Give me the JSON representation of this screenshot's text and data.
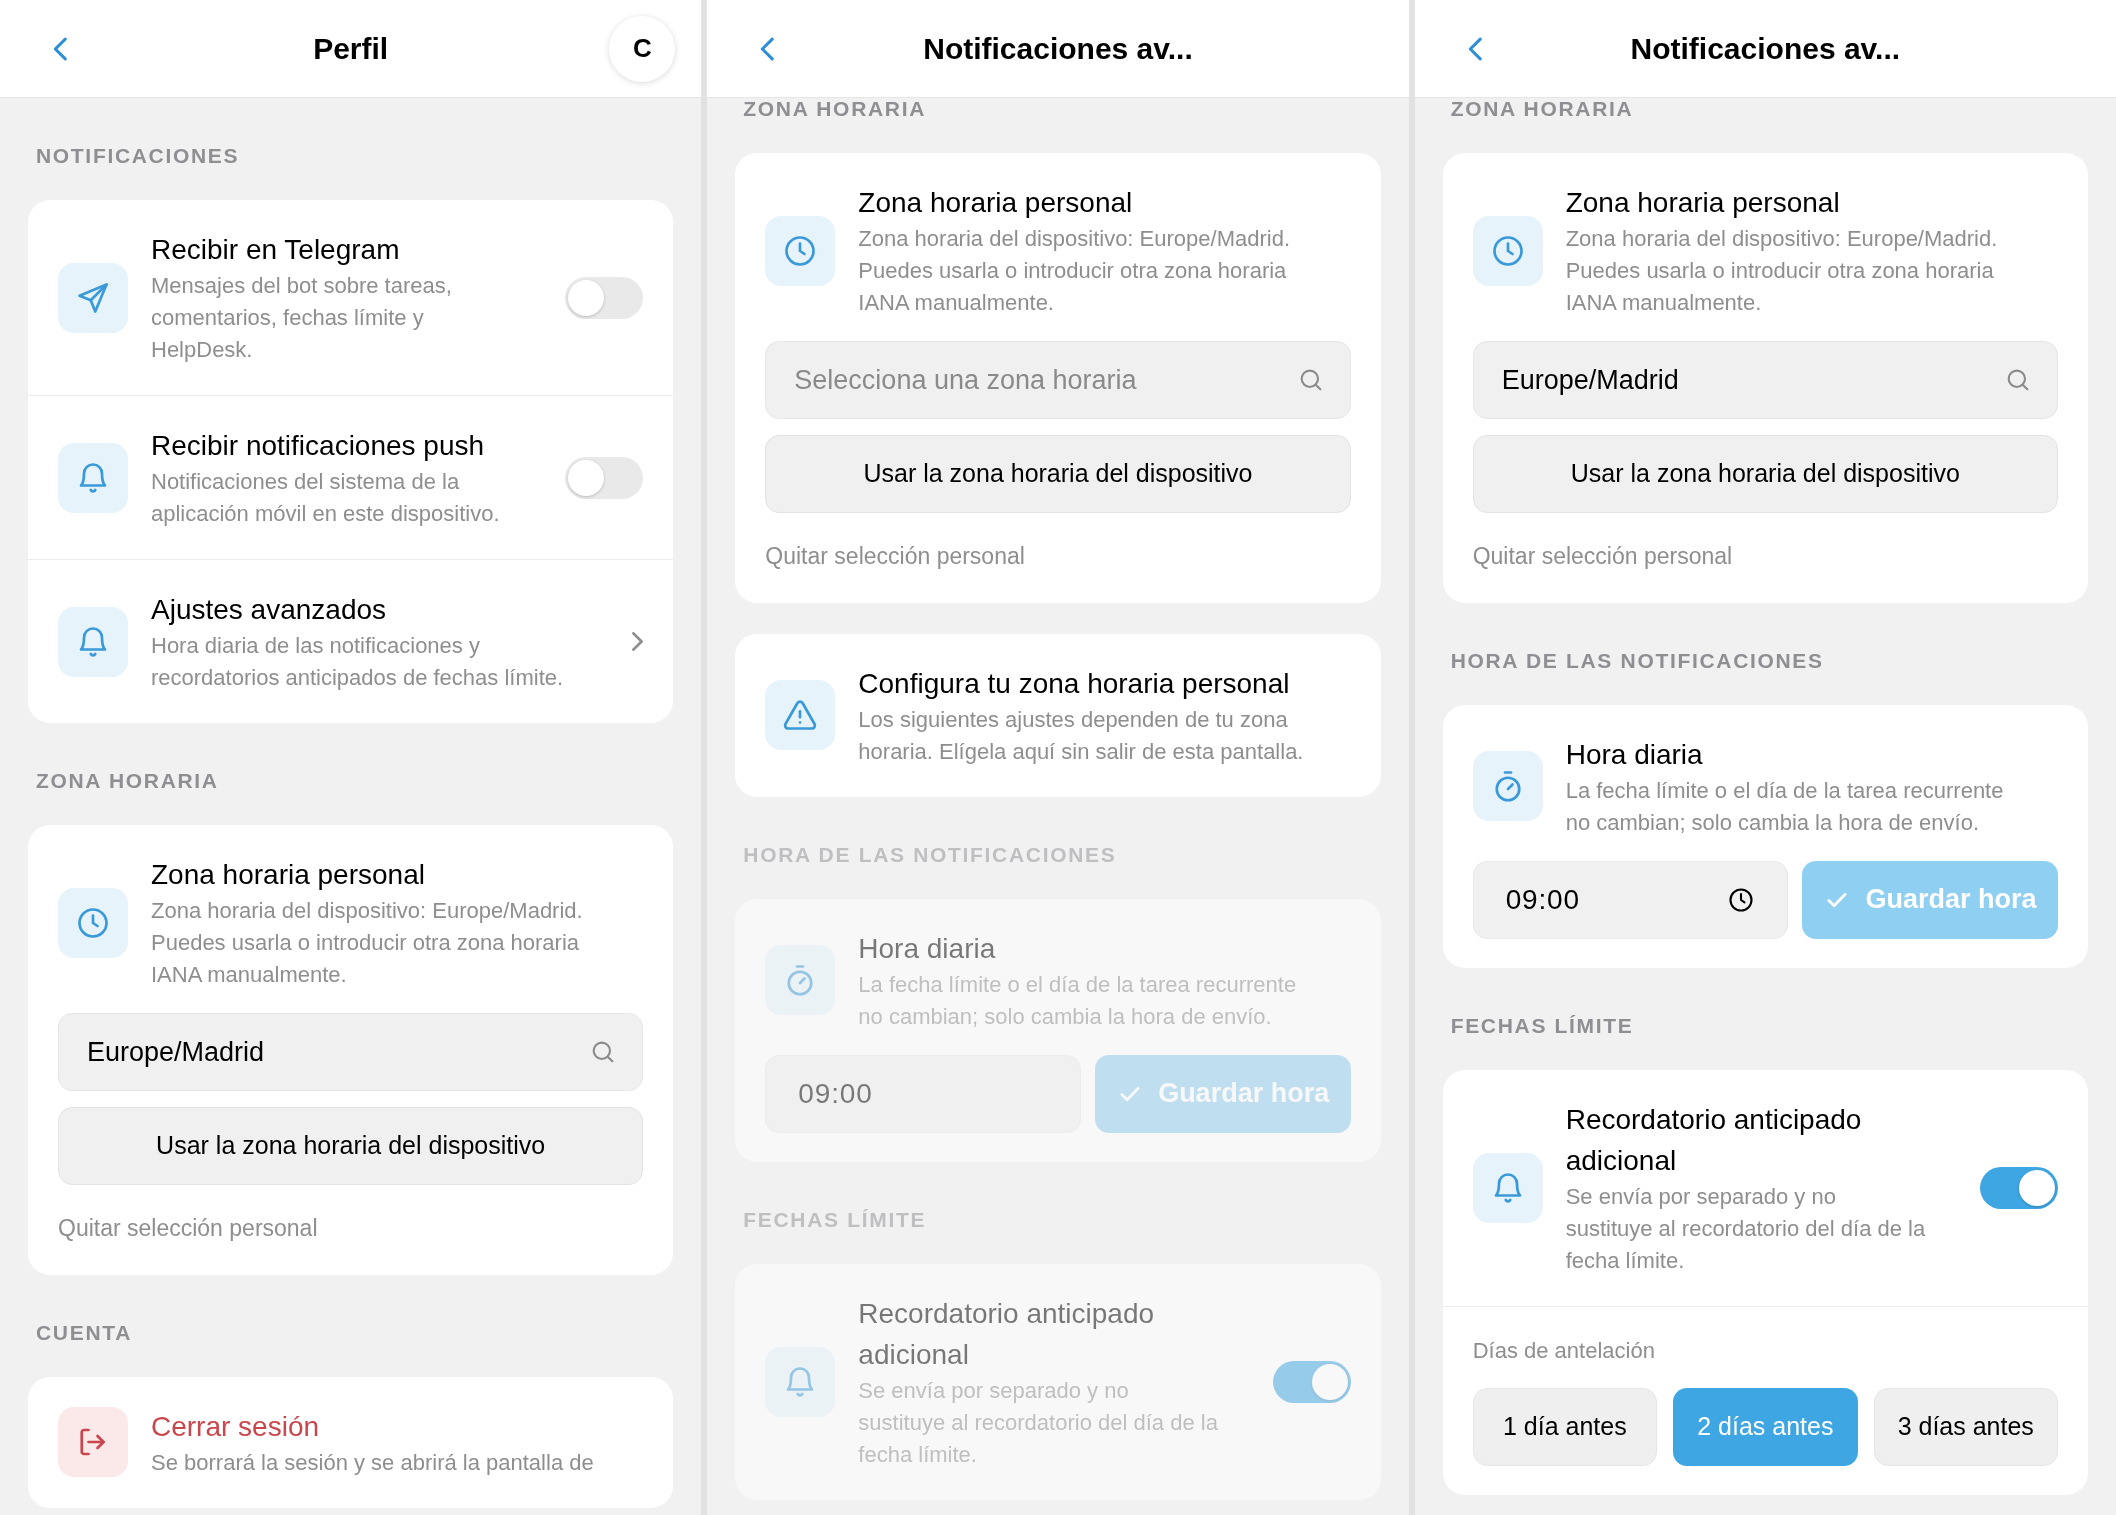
{
  "panels": [
    {
      "header": {
        "title": "Perfil",
        "avatar": "C"
      },
      "scrolled": false,
      "sections": [
        {
          "heading": "NOTIFICACIONES",
          "disabled": false,
          "items": [
            {
              "kind": "telegram",
              "title": "Recibir en Telegram",
              "description": "Mensajes del bot sobre tareas, comentarios, fechas límite y HelpDesk.",
              "on": false
            },
            {
              "kind": "push",
              "title": "Recibir notificaciones push",
              "description": "Notificaciones del sistema de la aplicación móvil en este dispositivo.",
              "on": false
            },
            {
              "kind": "advanced",
              "title": "Ajustes avanzados",
              "description": "Hora diaria de las notificaciones y recordatorios anticipados de fechas límite."
            }
          ]
        },
        {
          "heading": "ZONA HORARIA",
          "disabled": false,
          "items": [
            {
              "kind": "timezone",
              "title": "Zona horaria personal",
              "description": "Zona horaria del dispositivo: Europe/Madrid. Puedes usarla o introducir otra zona horaria IANA manualmente.",
              "field": {
                "value": "Europe/Madrid"
              },
              "button": "Usar la zona horaria del dispositivo",
              "link": "Quitar selección personal"
            }
          ]
        },
        {
          "heading": "CUENTA",
          "disabled": false,
          "items": [
            {
              "kind": "logout",
              "title": "Cerrar sesión",
              "description": "Se borrará la sesión y se abrirá la pantalla de"
            }
          ]
        }
      ]
    },
    {
      "header": {
        "title": "Notificaciones av..."
      },
      "scrolled": true,
      "sections": [
        {
          "heading": "ZONA HORARIA",
          "disabled": false,
          "items": [
            {
              "kind": "timezone",
              "title": "Zona horaria personal",
              "description": "Zona horaria del dispositivo: Europe/Madrid. Puedes usarla o introducir otra zona horaria IANA manualmente.",
              "field": {
                "placeholder": "Selecciona una zona horaria"
              },
              "button": "Usar la zona horaria del dispositivo",
              "link": "Quitar selección personal"
            }
          ]
        },
        {
          "disabled": false,
          "items": [
            {
              "kind": "warning",
              "title": "Configura tu zona horaria personal",
              "description": "Los siguientes ajustes dependen de tu zona horaria. Elígela aquí sin salir de esta pantalla."
            }
          ]
        },
        {
          "heading": "HORA DE LAS NOTIFICACIONES",
          "disabled": true,
          "items": [
            {
              "kind": "time",
              "title": "Hora diaria",
              "description": "La fecha límite o el día de la tarea recurrente no cambian; solo cambia la hora de envío.",
              "time": "09:00",
              "button": "Guardar hora"
            }
          ]
        },
        {
          "heading": "FECHAS LÍMITE",
          "disabled": true,
          "items": [
            {
              "kind": "reminder",
              "title": "Recordatorio anticipado adicional",
              "description": "Se envía por separado y no sustituye al recordatorio del día de la fecha límite.",
              "on": true
            }
          ]
        }
      ]
    },
    {
      "header": {
        "title": "Notificaciones av..."
      },
      "scrolled": true,
      "sections": [
        {
          "heading": "ZONA HORARIA",
          "disabled": false,
          "items": [
            {
              "kind": "timezone",
              "title": "Zona horaria personal",
              "description": "Zona horaria del dispositivo: Europe/Madrid. Puedes usarla o introducir otra zona horaria IANA manualmente.",
              "field": {
                "value": "Europe/Madrid"
              },
              "button": "Usar la zona horaria del dispositivo",
              "link": "Quitar selección personal"
            }
          ]
        },
        {
          "heading": "HORA DE LAS NOTIFICACIONES",
          "disabled": false,
          "items": [
            {
              "kind": "time",
              "title": "Hora diaria",
              "description": "La fecha límite o el día de la tarea recurrente no cambian; solo cambia la hora de envío.",
              "time": "09:00",
              "button": "Guardar hora"
            }
          ]
        },
        {
          "heading": "FECHAS LÍMITE",
          "disabled": false,
          "items": [
            {
              "kind": "reminder",
              "title": "Recordatorio anticipado adicional",
              "description": "Se envía por separado y no sustituye al recordatorio del día de la fecha límite.",
              "on": true
            },
            {
              "kind": "options",
              "label": "Días de antelación",
              "options": [
                {
                  "label": "1 día antes",
                  "selected": false
                },
                {
                  "label": "2 días antes",
                  "selected": true
                },
                {
                  "label": "3 días antes",
                  "selected": false
                }
              ]
            }
          ]
        }
      ]
    }
  ]
}
